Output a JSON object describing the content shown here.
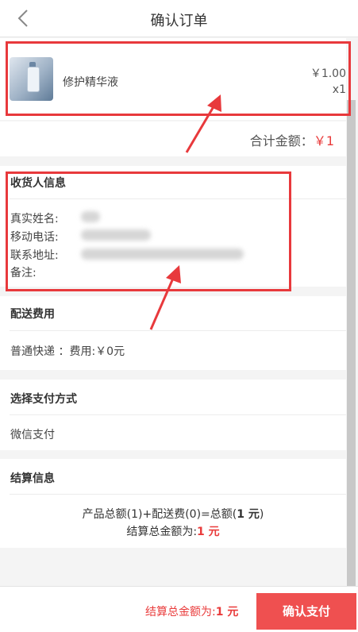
{
  "header": {
    "title": "确认订单",
    "back_icon": "chevron-left-icon"
  },
  "product": {
    "name": "修护精华液",
    "price": "￥1.00",
    "qty": "x1",
    "thumb_icon": "product-bottle-image"
  },
  "total": {
    "label": "合计金额：",
    "value": "￥1"
  },
  "receiver": {
    "heading": "收货人信息",
    "name_label": "真实姓名:",
    "phone_label": "移动电话:",
    "address_label": "联系地址:",
    "note_label": "备注:"
  },
  "shipping": {
    "heading": "配送费用",
    "method": "普通快递 ：费用:￥0元"
  },
  "payment": {
    "heading": "选择支付方式",
    "method": "微信支付"
  },
  "settlement": {
    "heading": "结算信息",
    "formula_prefix": "产品总额(1)+配送费(0)=总额(",
    "formula_value": "1 元",
    "formula_suffix": ")",
    "total_prefix": "结算总金额为:",
    "total_value": "1 元"
  },
  "footer": {
    "total_prefix": "结算总金额为:",
    "total_value": "1 元",
    "pay_button": "确认支付"
  },
  "colors": {
    "accent": "#e93b3b",
    "pay_button_bg": "#ef5050",
    "annotation": "#e8393c"
  }
}
